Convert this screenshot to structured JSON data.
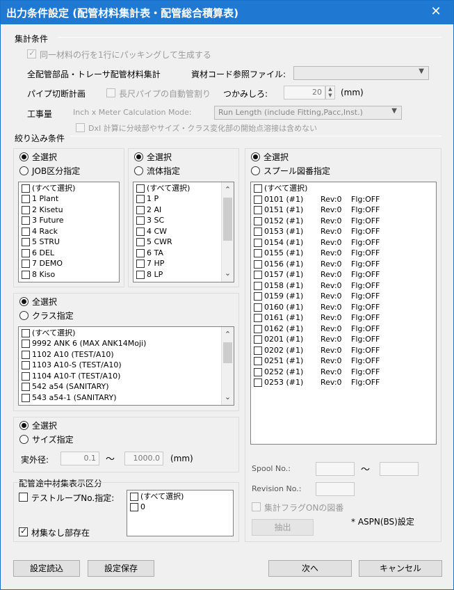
{
  "window": {
    "title": "出力条件設定 (配管材料集計表・配管総合積算表)",
    "close_glyph": "✕"
  },
  "aggregation": {
    "section_label": "集計条件",
    "packing_label": "同一材料の行を1行にパッキングして生成する",
    "all_parts_label": "全配管部品・トレーサ配管材料集計",
    "material_code_label": "資材コード参照ファイル:",
    "material_code_value": "",
    "pipe_cut_label": "パイプ切断計画",
    "long_pipe_label": "長尺パイプの自動管割り",
    "grip_label": "つかみしろ:",
    "grip_value": "20",
    "grip_unit": "(mm)",
    "work_label": "工事量",
    "mode_label": "Inch x Meter Calculation Mode:",
    "mode_value": "Run Length (include Fitting,Pacc,Inst.)",
    "dxi_label": "DxI 計算に分岐部やサイズ・クラス変化部の開始点溶接は含めない"
  },
  "filter": {
    "section_label": "絞り込み条件"
  },
  "job": {
    "select_all": "全選択",
    "specify": "JOB区分指定",
    "items": [
      "(すべて選択)",
      "1    Plant",
      "2    Kisetu",
      "3    Future",
      "4    Rack",
      "5    STRU",
      "6    DEL",
      "7    DEMO",
      "8    Kiso"
    ]
  },
  "fluid": {
    "select_all": "全選択",
    "specify": "流体指定",
    "items": [
      "(すべて選択)",
      "1    P",
      "2    AI",
      "3    SC",
      "4    CW",
      "5    CWR",
      "6    TA",
      "7    HP",
      "8    LP"
    ]
  },
  "spool": {
    "select_all": "全選択",
    "specify": "スプール図番指定",
    "items": [
      {
        "id": "(すべて選択)",
        "rev": "",
        "flg": ""
      },
      {
        "id": "0101 (#1)",
        "rev": "Rev:0",
        "flg": "Flg:OFF"
      },
      {
        "id": "0151 (#1)",
        "rev": "Rev:0",
        "flg": "Flg:OFF"
      },
      {
        "id": "0152 (#1)",
        "rev": "Rev:0",
        "flg": "Flg:OFF"
      },
      {
        "id": "0153 (#1)",
        "rev": "Rev:0",
        "flg": "Flg:OFF"
      },
      {
        "id": "0154 (#1)",
        "rev": "Rev:0",
        "flg": "Flg:OFF"
      },
      {
        "id": "0155 (#1)",
        "rev": "Rev:0",
        "flg": "Flg:OFF"
      },
      {
        "id": "0156 (#1)",
        "rev": "Rev:0",
        "flg": "Flg:OFF"
      },
      {
        "id": "0157 (#1)",
        "rev": "Rev:0",
        "flg": "Flg:OFF"
      },
      {
        "id": "0158 (#1)",
        "rev": "Rev:0",
        "flg": "Flg:OFF"
      },
      {
        "id": "0159 (#1)",
        "rev": "Rev:0",
        "flg": "Flg:OFF"
      },
      {
        "id": "0160 (#1)",
        "rev": "Rev:0",
        "flg": "Flg:OFF"
      },
      {
        "id": "0161 (#1)",
        "rev": "Rev:0",
        "flg": "Flg:OFF"
      },
      {
        "id": "0162 (#1)",
        "rev": "Rev:0",
        "flg": "Flg:OFF"
      },
      {
        "id": "0201 (#1)",
        "rev": "Rev:0",
        "flg": "Flg:OFF"
      },
      {
        "id": "0202 (#1)",
        "rev": "Rev:0",
        "flg": "Flg:OFF"
      },
      {
        "id": "0251 (#1)",
        "rev": "Rev:0",
        "flg": "Flg:OFF"
      },
      {
        "id": "0252 (#1)",
        "rev": "Rev:0",
        "flg": "Flg:OFF"
      },
      {
        "id": "0253 (#1)",
        "rev": "Rev:0",
        "flg": "Flg:OFF"
      }
    ],
    "spool_no_label": "Spool No.:",
    "tilde": "～",
    "revision_label": "Revision No.:",
    "flag_label": "集計フラグONの図番",
    "extract_label": "抽出",
    "aspn_label": "* ASPN(BS)設定"
  },
  "class": {
    "select_all": "全選択",
    "specify": "クラス指定",
    "items": [
      "(すべて選択)",
      "9992  ANK 6 (MAX ANK14Moji)",
      "1102  A10 (TEST/A10)",
      "1103  A10-S (TEST/A10)",
      "1104  A10-T (TEST/A10)",
      "542   a54 (SANITARY)",
      "543   a54-1 (SANITARY)"
    ]
  },
  "size": {
    "select_all": "全選択",
    "specify": "サイズ指定",
    "od_label": "実外径:",
    "od_min": "0.1",
    "tilde": "～",
    "od_max": "1000.0",
    "unit": "(mm)"
  },
  "midway": {
    "section_label": "配管途中材集表示区分",
    "testloop_label": "テストループNo.指定:",
    "no_material_label": "材集なし部存在",
    "items": [
      "(すべて選択)",
      "0"
    ]
  },
  "buttons": {
    "load": "設定読込",
    "save": "設定保存",
    "next": "次へ",
    "cancel": "キャンセル"
  }
}
